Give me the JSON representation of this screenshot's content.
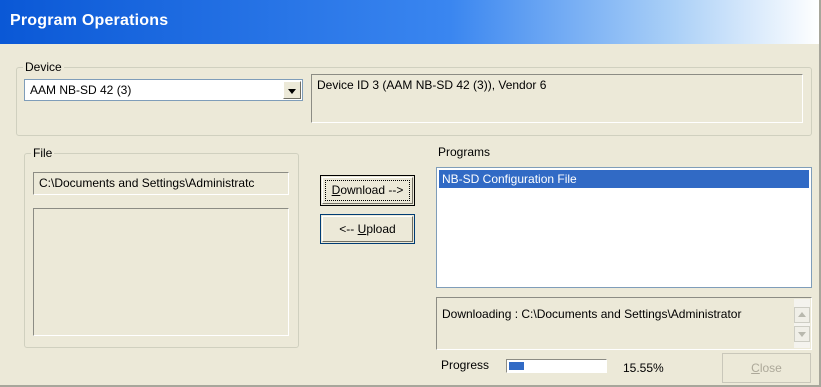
{
  "window": {
    "title": "Program Operations"
  },
  "device": {
    "legend": "Device",
    "selected": "AAM NB-SD 42 (3)",
    "info": "Device ID 3 (AAM NB-SD 42 (3)), Vendor 6"
  },
  "file": {
    "legend": "File",
    "path": "C:\\Documents and Settings\\Administratc"
  },
  "actions": {
    "download_prefix": "",
    "download_mnemonic": "D",
    "download_rest": "ownload -->",
    "upload_prefix": "<-- ",
    "upload_mnemonic": "U",
    "upload_rest": "pload"
  },
  "programs": {
    "label": "Programs",
    "items": [
      "NB-SD Configuration File"
    ],
    "selected_index": 0
  },
  "status": {
    "text": "Downloading : C:\\Documents and Settings\\Administrator"
  },
  "progress": {
    "label": "Progress",
    "value_text": "15.55%",
    "fraction": 0.1555
  },
  "footer": {
    "close_mnemonic": "C",
    "close_rest": "lose"
  }
}
